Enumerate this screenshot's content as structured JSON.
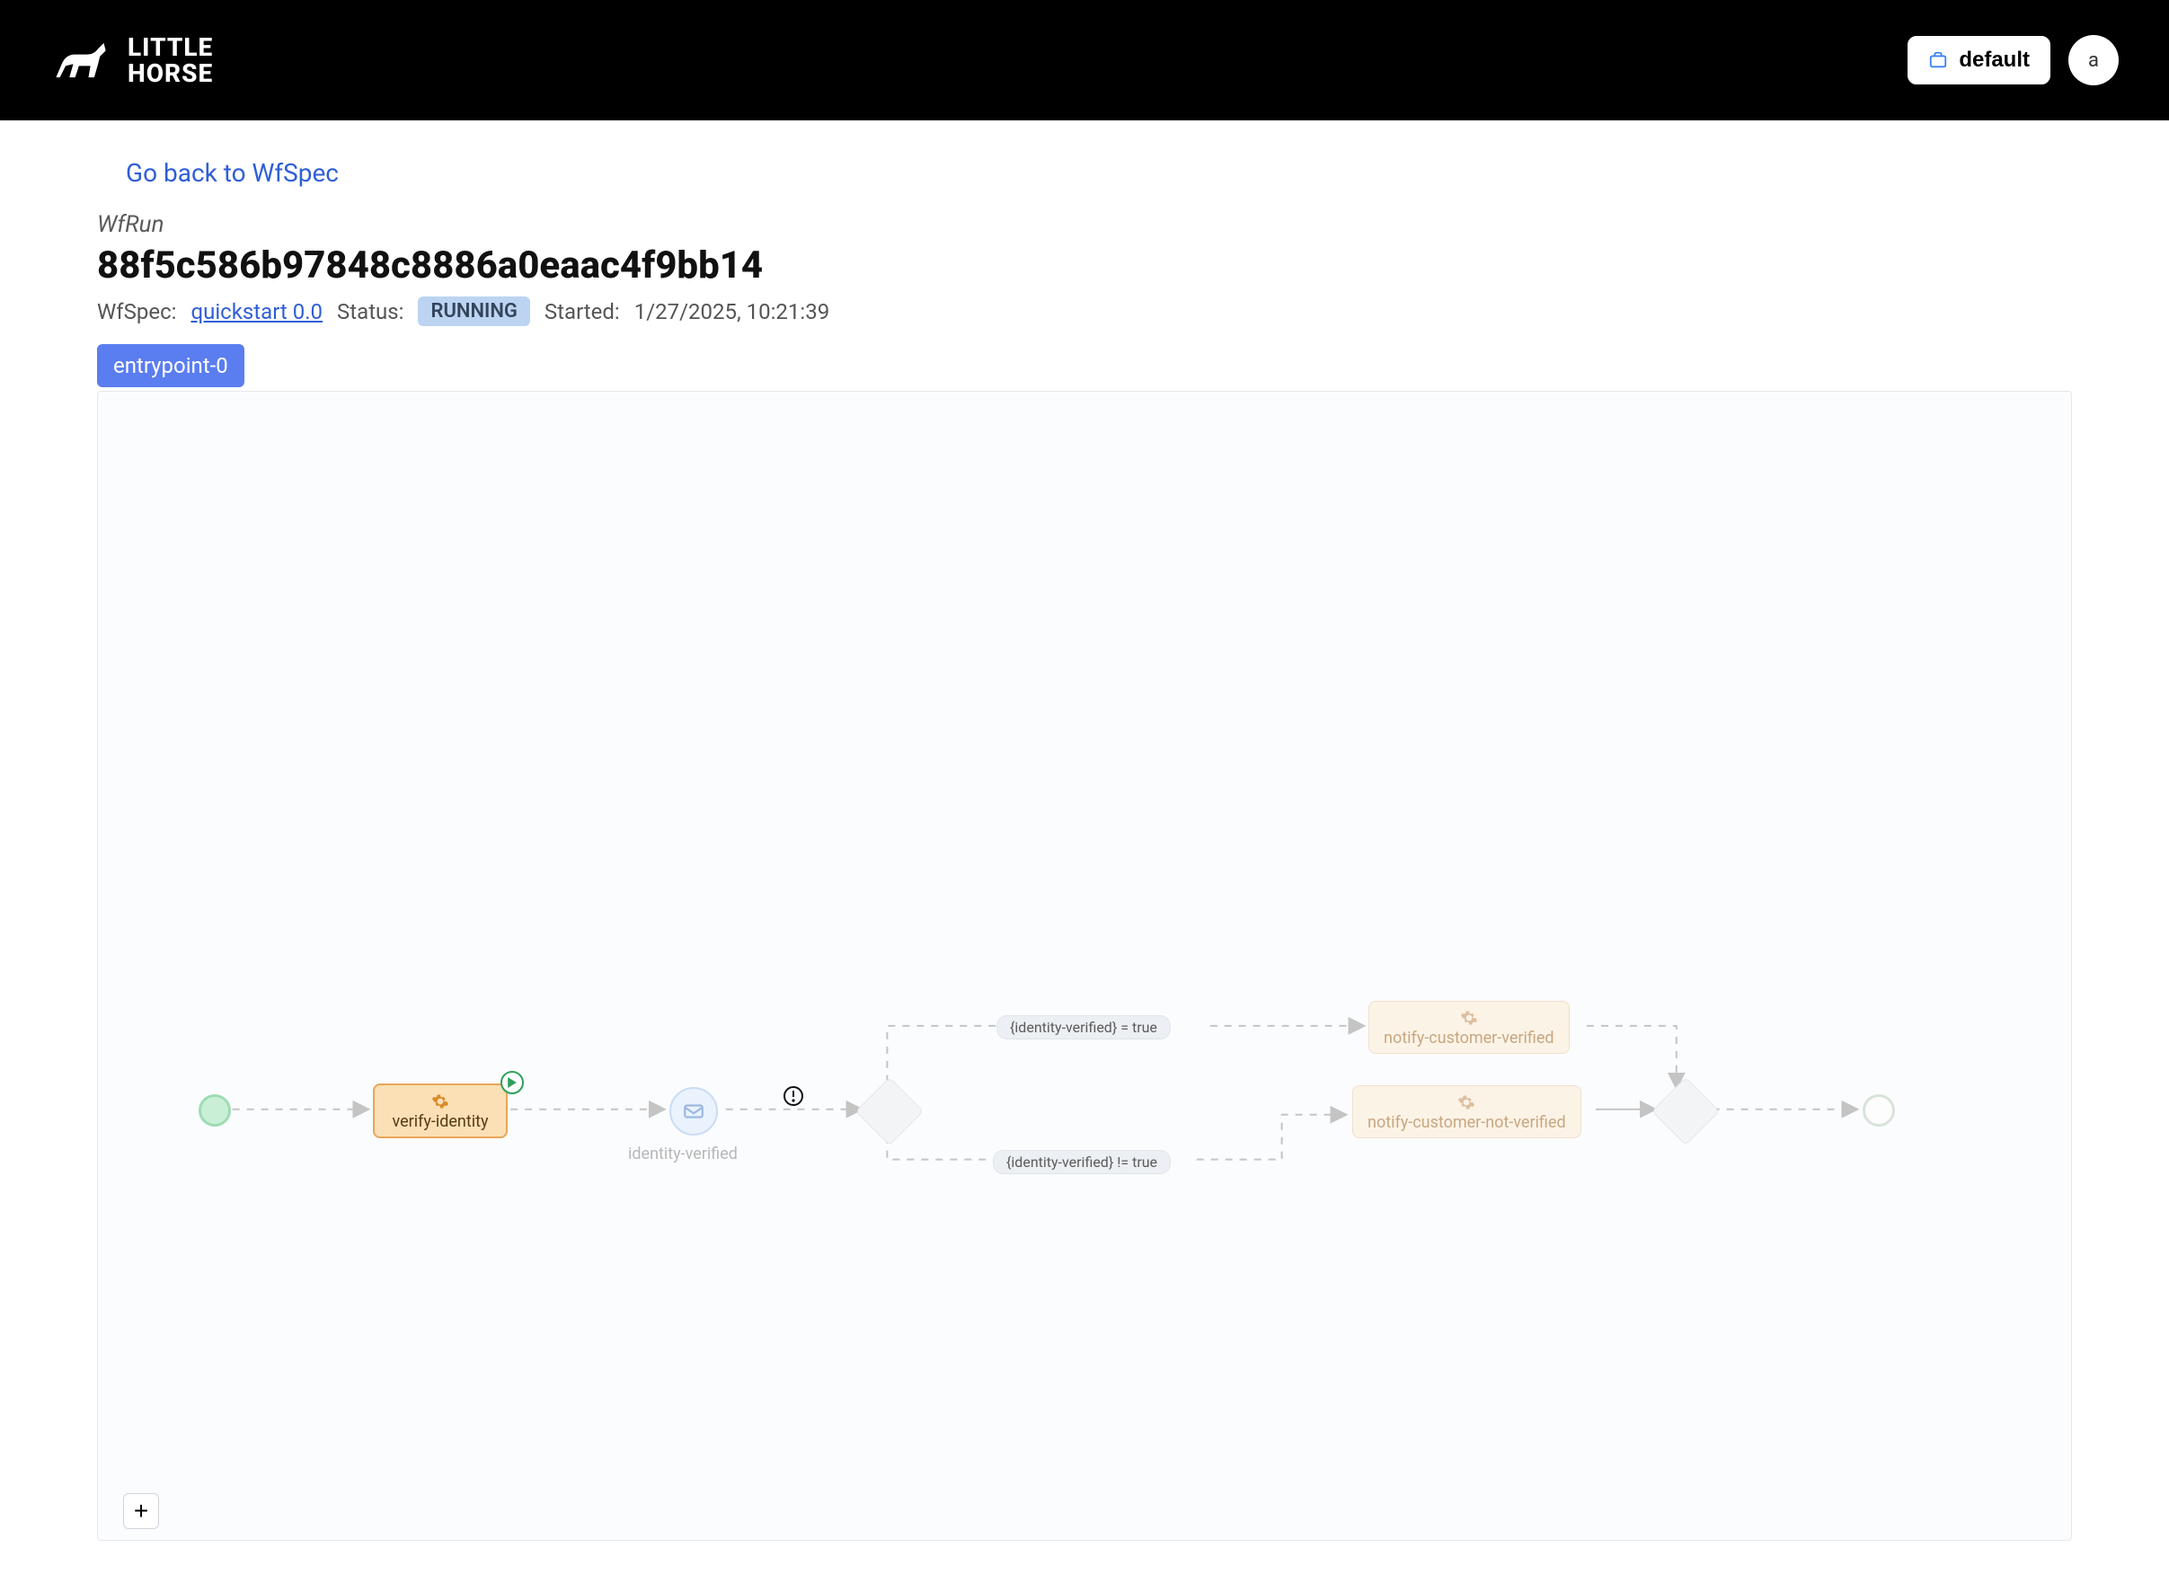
{
  "header": {
    "brand_line1": "LITTLE",
    "brand_line2": "HORSE",
    "workspace_button": "default",
    "avatar_letter": "a"
  },
  "page": {
    "back_link": "Go back to WfSpec",
    "section_label": "WfRun",
    "run_id": "88f5c586b97848c8886a0eaac4f9bb14",
    "wfspec_label": "WfSpec:",
    "wfspec_link": "quickstart 0.0",
    "status_label": "Status:",
    "status_value": "RUNNING",
    "started_label": "Started:",
    "started_value": "1/27/2025, 10:21:39"
  },
  "tabs": [
    {
      "label": "entrypoint-0"
    }
  ],
  "diagram": {
    "nodes": {
      "verify_identity": "verify-identity",
      "identity_verified_label": "identity-verified",
      "notify_verified": "notify-customer-verified",
      "notify_not_verified": "notify-customer-not-verified"
    },
    "conditions": {
      "true_branch": "{identity-verified} = true",
      "false_branch": "{identity-verified} != true"
    }
  },
  "controls": {
    "zoom_in": "+"
  }
}
